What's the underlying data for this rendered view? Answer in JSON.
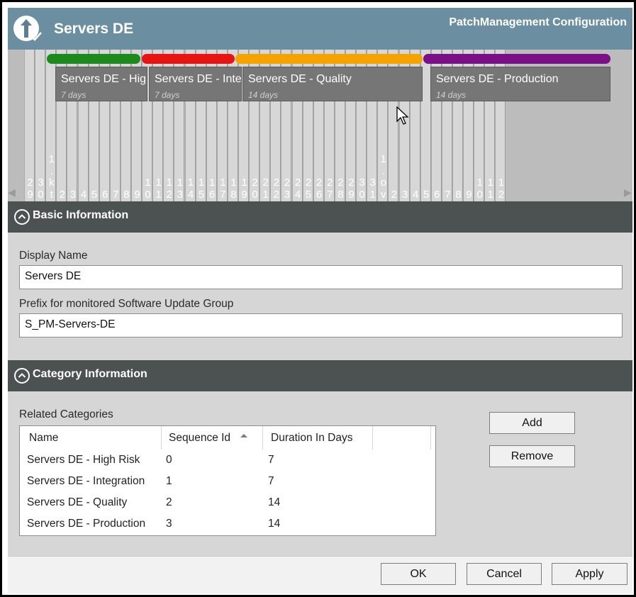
{
  "header": {
    "title": "Servers DE",
    "app_name": "PatchManagement Configuration",
    "icon": "upload-check-icon"
  },
  "timeline": {
    "day_labels": [
      "29",
      "30",
      "1\n.\nk\nt",
      "2",
      "3",
      "4",
      "5",
      "6",
      "7",
      "8",
      "9",
      "10",
      "11",
      "12",
      "13",
      "14",
      "15",
      "16",
      "17",
      "18",
      "19",
      "20",
      "21",
      "22",
      "23",
      "24",
      "25",
      "26",
      "27",
      "28",
      "29",
      "30",
      "31",
      "1\n.\no\nv",
      "2",
      "3",
      "4",
      "5",
      "6",
      "7",
      "8",
      "9",
      "10",
      "11",
      "12"
    ],
    "phases": [
      {
        "name": "Servers DE - High Risk",
        "display": "Servers DE - Hig",
        "days": "7 days",
        "color": "#1c8a1c"
      },
      {
        "name": "Servers DE - Integration",
        "display": "Servers DE - Inte",
        "days": "7 days",
        "color": "#e81414"
      },
      {
        "name": "Servers DE - Quality",
        "display": "Servers DE - Quality",
        "days": "14 days",
        "color": "#f5a300"
      },
      {
        "name": "Servers DE - Production",
        "display": "Servers DE - Production",
        "days": "14 days",
        "color": "#7a0f86"
      }
    ]
  },
  "basic": {
    "section_title": "Basic Information",
    "display_name_label": "Display Name",
    "display_name_value": "Servers DE",
    "prefix_label": "Prefix for monitored Software Update Group",
    "prefix_value": "S_PM-Servers-DE"
  },
  "category": {
    "section_title": "Category Information",
    "related_label": "Related Categories",
    "columns": [
      "Name",
      "Sequence Id",
      "Duration In Days"
    ],
    "rows": [
      {
        "name": "Servers DE - High Risk",
        "seq": "0",
        "duration": "7"
      },
      {
        "name": "Servers DE - Integration",
        "seq": "1",
        "duration": "7"
      },
      {
        "name": "Servers DE - Quality",
        "seq": "2",
        "duration": "14"
      },
      {
        "name": "Servers DE - Production",
        "seq": "3",
        "duration": "14"
      }
    ],
    "add_label": "Add",
    "remove_label": "Remove"
  },
  "footer": {
    "ok_label": "OK",
    "cancel_label": "Cancel",
    "apply_label": "Apply"
  }
}
